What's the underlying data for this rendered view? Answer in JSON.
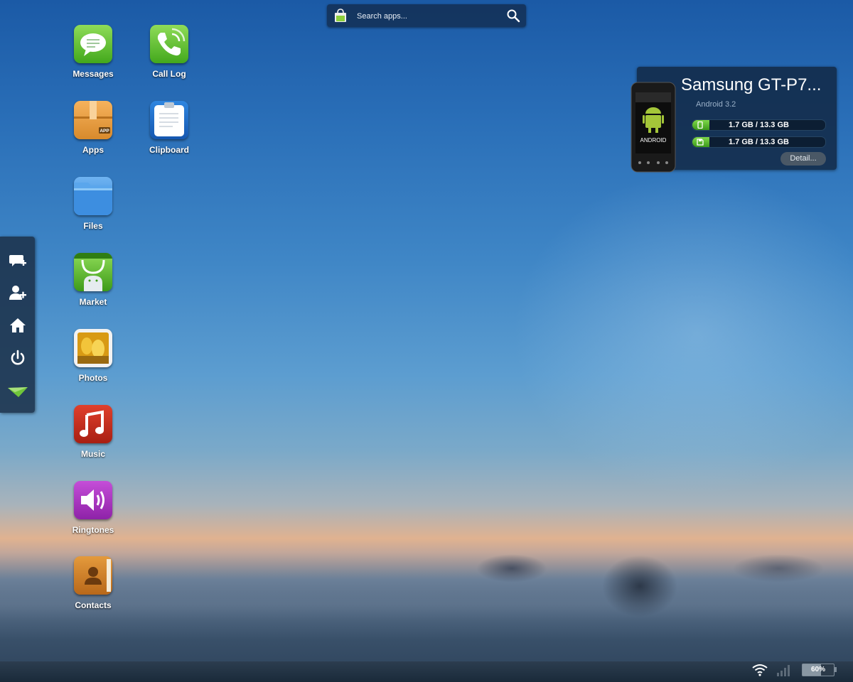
{
  "search": {
    "placeholder": "Search apps..."
  },
  "apps": [
    {
      "label": "Messages",
      "icon": "messages-icon"
    },
    {
      "label": "Call Log",
      "icon": "call-log-icon"
    },
    {
      "label": "Apps",
      "icon": "apps-box-icon"
    },
    {
      "label": "Clipboard",
      "icon": "clipboard-icon"
    },
    {
      "label": "Files",
      "icon": "folder-icon"
    },
    {
      "label": "Market",
      "icon": "market-bag-icon"
    },
    {
      "label": "Photos",
      "icon": "photos-icon"
    },
    {
      "label": "Music",
      "icon": "music-note-icon"
    },
    {
      "label": "Ringtones",
      "icon": "speaker-icon"
    },
    {
      "label": "Contacts",
      "icon": "contacts-book-icon"
    }
  ],
  "apps_box_badge": "APP",
  "dock": {
    "items": [
      "new-message-icon",
      "add-contact-icon",
      "home-icon",
      "power-icon",
      "send-paper-plane-icon"
    ]
  },
  "device": {
    "name": "Samsung GT-P7...",
    "os": "Android 3.2",
    "phone_logo": "ANDROID",
    "storage": [
      {
        "text": "1.7 GB / 13.3 GB",
        "used_fraction": 0.128,
        "icon": "phone-storage-icon"
      },
      {
        "text": "1.7 GB / 13.3 GB",
        "used_fraction": 0.128,
        "icon": "sd-card-icon"
      }
    ],
    "detail_label": "Detail..."
  },
  "status": {
    "battery_text": "60%",
    "battery_fraction": 0.6,
    "signal_bars_active": 0,
    "wifi": "wifi-icon"
  },
  "colors": {
    "accent_green": "#5cb82e",
    "panel": "#122844"
  }
}
